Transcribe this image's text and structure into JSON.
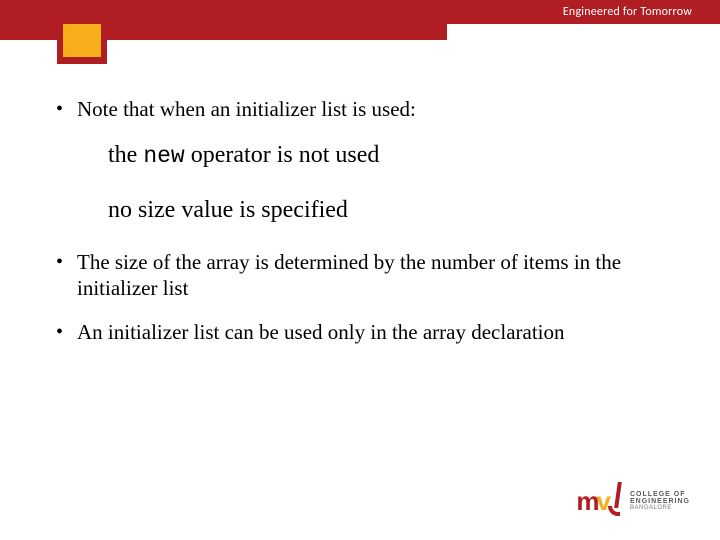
{
  "header": {
    "tagline": "Engineered for Tomorrow"
  },
  "bullets": {
    "b1": "Note that when an initializer list is used:",
    "indent1_pre": "the ",
    "indent1_mono": "new",
    "indent1_post": " operator is not used",
    "indent2": "no size value is specified",
    "b2": "The size of the array is determined by the number of items in the initializer list",
    "b3": "An initializer list can be used only in the array declaration"
  },
  "logo": {
    "m": "m",
    "v": "v",
    "text_line1": "COLLEGE OF",
    "text_line2": "ENGINEERING",
    "text_line3": "BANGALORE"
  }
}
